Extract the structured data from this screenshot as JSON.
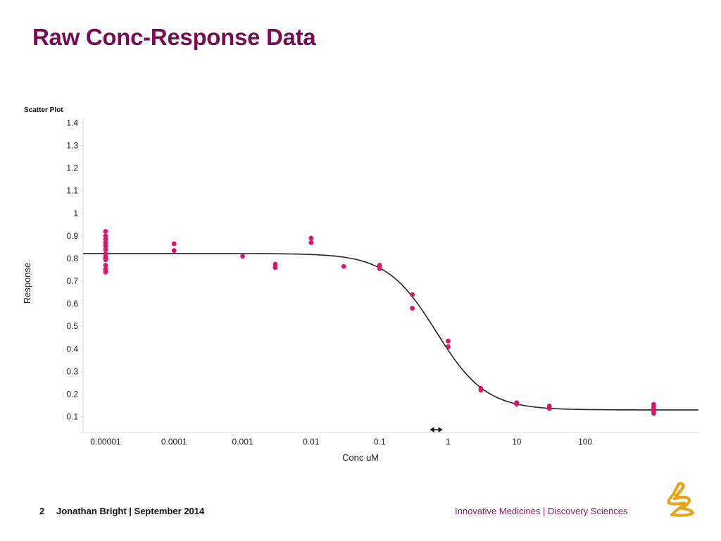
{
  "slide": {
    "title": "Raw Conc-Response Data",
    "page_number": "2",
    "author_date": "Jonathan Bright | September 2014",
    "division": "Innovative Medicines | Discovery Sciences",
    "logo_icon": "company-logo-icon"
  },
  "colors": {
    "title": "#7b0a55",
    "points": "#e0136a",
    "curve": "#222222",
    "division_text": "#8a1a6a",
    "logo": "#e8a317"
  },
  "chart_data": {
    "type": "scatter",
    "title": "Scatter Plot",
    "xlabel": "Conc uM",
    "ylabel": "Response",
    "xscale": "log",
    "xlim": [
      4.7e-06,
      4500
    ],
    "ylim": [
      0.03,
      1.42
    ],
    "xticks": [
      1e-05,
      0.0001,
      0.001,
      0.01,
      0.1,
      1,
      10,
      100
    ],
    "xtick_labels": [
      "0.00001",
      "0.0001",
      "0.001",
      "0.01",
      "0.1",
      "1",
      "10",
      "100"
    ],
    "yticks": [
      0.1,
      0.2,
      0.3,
      0.4,
      0.5,
      0.6,
      0.7,
      0.8,
      0.9,
      1,
      1.1,
      1.2,
      1.3,
      1.4
    ],
    "ytick_labels": [
      "0.1",
      "0.2",
      "0.3",
      "0.4",
      "0.5",
      "0.6",
      "0.7",
      "0.8",
      "0.9",
      "1",
      "1.1",
      "1.2",
      "1.3",
      "1.4"
    ],
    "grid": false,
    "points": [
      {
        "x": 1e-05,
        "y": 0.92
      },
      {
        "x": 1e-05,
        "y": 0.9
      },
      {
        "x": 1e-05,
        "y": 0.885
      },
      {
        "x": 1e-05,
        "y": 0.87
      },
      {
        "x": 1e-05,
        "y": 0.855
      },
      {
        "x": 1e-05,
        "y": 0.84
      },
      {
        "x": 1e-05,
        "y": 0.82
      },
      {
        "x": 1e-05,
        "y": 0.805
      },
      {
        "x": 1e-05,
        "y": 0.795
      },
      {
        "x": 1e-05,
        "y": 0.77
      },
      {
        "x": 1e-05,
        "y": 0.752
      },
      {
        "x": 1e-05,
        "y": 0.74
      },
      {
        "x": 0.0001,
        "y": 0.865
      },
      {
        "x": 0.0001,
        "y": 0.835
      },
      {
        "x": 0.001,
        "y": 0.81
      },
      {
        "x": 0.003,
        "y": 0.775
      },
      {
        "x": 0.003,
        "y": 0.76
      },
      {
        "x": 0.01,
        "y": 0.89
      },
      {
        "x": 0.01,
        "y": 0.87
      },
      {
        "x": 0.03,
        "y": 0.765
      },
      {
        "x": 0.1,
        "y": 0.77
      },
      {
        "x": 0.1,
        "y": 0.755
      },
      {
        "x": 0.3,
        "y": 0.64
      },
      {
        "x": 0.3,
        "y": 0.58
      },
      {
        "x": 1,
        "y": 0.435
      },
      {
        "x": 1,
        "y": 0.41
      },
      {
        "x": 3,
        "y": 0.225
      },
      {
        "x": 3,
        "y": 0.218
      },
      {
        "x": 10,
        "y": 0.162
      },
      {
        "x": 10,
        "y": 0.155
      },
      {
        "x": 30,
        "y": 0.147
      },
      {
        "x": 30,
        "y": 0.137
      },
      {
        "x": 1000,
        "y": 0.155
      },
      {
        "x": 1000,
        "y": 0.145
      },
      {
        "x": 1000,
        "y": 0.135
      },
      {
        "x": 1000,
        "y": 0.125
      },
      {
        "x": 1000,
        "y": 0.115
      }
    ],
    "fit_curve": {
      "model": "4-parameter logistic",
      "top": 0.822,
      "bottom": 0.13,
      "ic50": 0.67,
      "hill": 1.2
    },
    "ic50_marker": {
      "x": 0.67,
      "symbol": "double-arrow"
    }
  }
}
